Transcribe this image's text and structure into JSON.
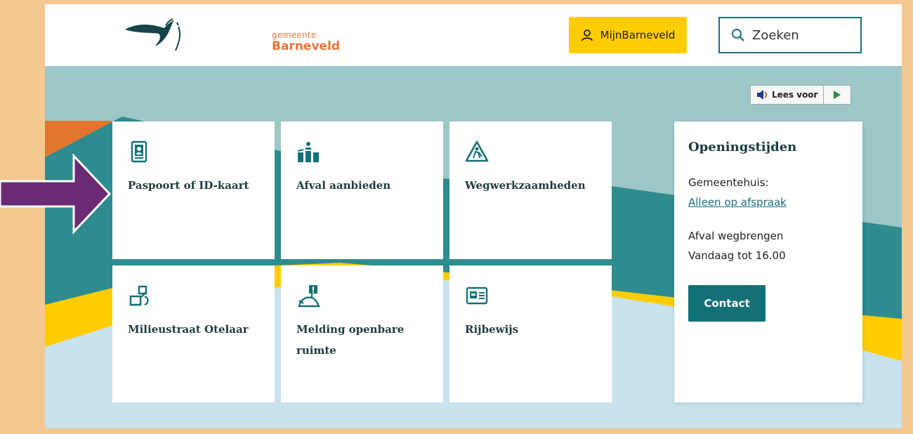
{
  "header": {
    "logo_small": "gemeente",
    "logo_big": "Barneveld",
    "account_label": "MijnBarneveld",
    "search_label": "Zoeken"
  },
  "readspeaker": {
    "listen_label": "Lees voor"
  },
  "tiles": [
    {
      "label": "Paspoort of ID-kaart",
      "icon": "passport-icon"
    },
    {
      "label": "Afval aanbieden",
      "icon": "waste-bins-icon"
    },
    {
      "label": "Wegwerkzaamheden",
      "icon": "roadworks-icon"
    },
    {
      "label": "Milieustraat Otelaar",
      "icon": "recycling-station-icon"
    },
    {
      "label": "Melding openbare ruimte",
      "icon": "public-space-report-icon"
    },
    {
      "label": "Rijbewijs",
      "icon": "driving-license-icon"
    }
  ],
  "opening": {
    "title": "Openingstijden",
    "townhall_label": "Gemeentehuis:",
    "townhall_link": "Alleen op afspraak",
    "waste_label": "Afval wegbrengen",
    "waste_time": "Vandaag tot 16.00",
    "contact_label": "Contact"
  },
  "colors": {
    "accent_teal": "#127177",
    "yellow": "#ffcc00",
    "orange": "#e8743b",
    "frame": "#f5c892",
    "annotation_arrow": "#6b2a73"
  }
}
